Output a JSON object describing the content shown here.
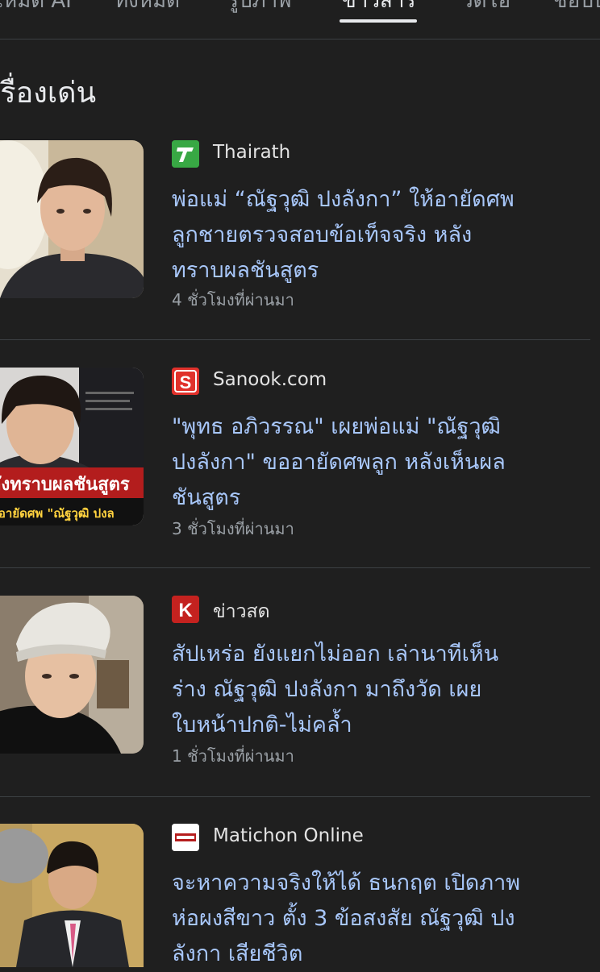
{
  "tabs": [
    {
      "label": "โหมด AI"
    },
    {
      "label": "ทั้งหมด"
    },
    {
      "label": "รูปภาพ"
    },
    {
      "label": "ข่าวสาร",
      "active": true
    },
    {
      "label": "วิดีโอ"
    },
    {
      "label": "ช็อปป"
    }
  ],
  "section_title": "เรื่องเด่น",
  "articles": [
    {
      "source": "Thairath",
      "source_icon": "thairath-logo-icon",
      "source_color": "#2e9e3a",
      "title_lines": [
        "พ่อแม่ “ณัฐวุฒิ ปงลังกา” ให้อายัดศพ",
        "ลูกชายตรวจสอบข้อเท็จจริง หลัง",
        "ทราบผลชันสูตร"
      ],
      "time": "4 ชั่วโมงที่ผ่านมา"
    },
    {
      "source": "Sanook.com",
      "source_icon": "sanook-logo-icon",
      "source_color": "#e0312b",
      "title_lines": [
        "\"พุทธ อภิวรรณ\" เผยพ่อแม่ \"ณัฐวุฒิ",
        "ปงลังกา\" ขออายัดศพลูก หลังเห็นผล",
        "ชันสูตร"
      ],
      "time": "3 ชั่วโมงที่ผ่านมา",
      "thumb_text": [
        "ลังทราบผลชันสูตร",
        "ห้อายัดศพ \"ณัฐวุฒิ ปงล"
      ]
    },
    {
      "source": "ข่าวสด",
      "source_icon": "khaosod-logo-icon",
      "source_color": "#c4221f",
      "title_lines": [
        "สัปเหร่อ ยังแยกไม่ออก เล่านาทีเห็น",
        "ร่าง ณัฐวุฒิ ปงลังกา มาถึงวัด เผย",
        "ใบหน้าปกติ-ไม่คล้ำ"
      ],
      "time": "1 ชั่วโมงที่ผ่านมา"
    },
    {
      "source": "Matichon Online",
      "source_icon": "matichon-logo-icon",
      "source_color": "#ffffff",
      "title_lines": [
        "จะหาความจริงให้ได้ ธนกฤต เปิดภาพ",
        "ห่อผงสีขาว ตั้ง 3 ข้อสงสัย ณัฐวุฒิ ปง",
        "ลังกา เสียชีวิต"
      ]
    }
  ]
}
